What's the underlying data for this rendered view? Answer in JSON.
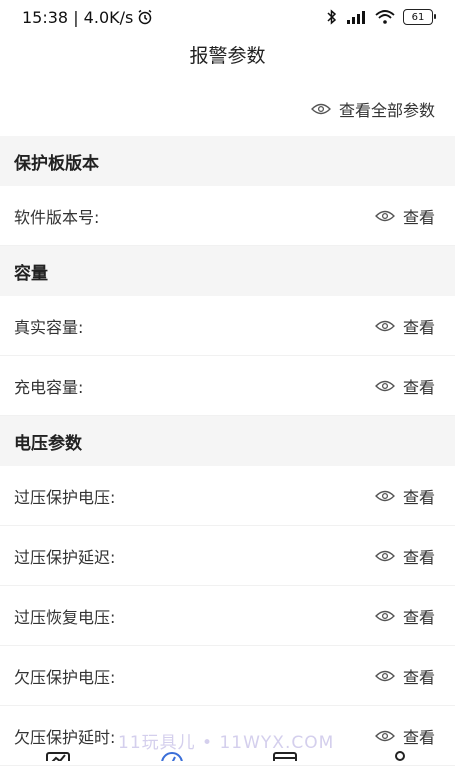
{
  "status_bar": {
    "time": "15:38 | 4.0K/s",
    "battery": "61"
  },
  "header": {
    "title": "报警参数"
  },
  "view_all": {
    "label": "查看全部参数"
  },
  "sections": [
    {
      "title": "保护板版本",
      "rows": [
        {
          "label": "软件版本号:",
          "action": "查看"
        }
      ]
    },
    {
      "title": "容量",
      "rows": [
        {
          "label": "真实容量:",
          "action": "查看"
        },
        {
          "label": "充电容量:",
          "action": "查看"
        }
      ]
    },
    {
      "title": "电压参数",
      "rows": [
        {
          "label": "过压保护电压:",
          "action": "查看"
        },
        {
          "label": "过压保护延迟:",
          "action": "查看"
        },
        {
          "label": "过压恢复电压:",
          "action": "查看"
        },
        {
          "label": "欠压保护电压:",
          "action": "查看"
        },
        {
          "label": "欠压保护延时:",
          "action": "查看"
        }
      ]
    }
  ],
  "watermark": "11玩具儿 • 11WYX.COM",
  "icons": {
    "eye": "eye-icon",
    "alarm": "alarm-clock-icon",
    "bluetooth": "bluetooth-icon",
    "signal": "signal-icon",
    "wifi": "wifi-icon"
  },
  "colors": {
    "section_bg": "#f5f5f5",
    "accent": "#3b6fd8"
  }
}
